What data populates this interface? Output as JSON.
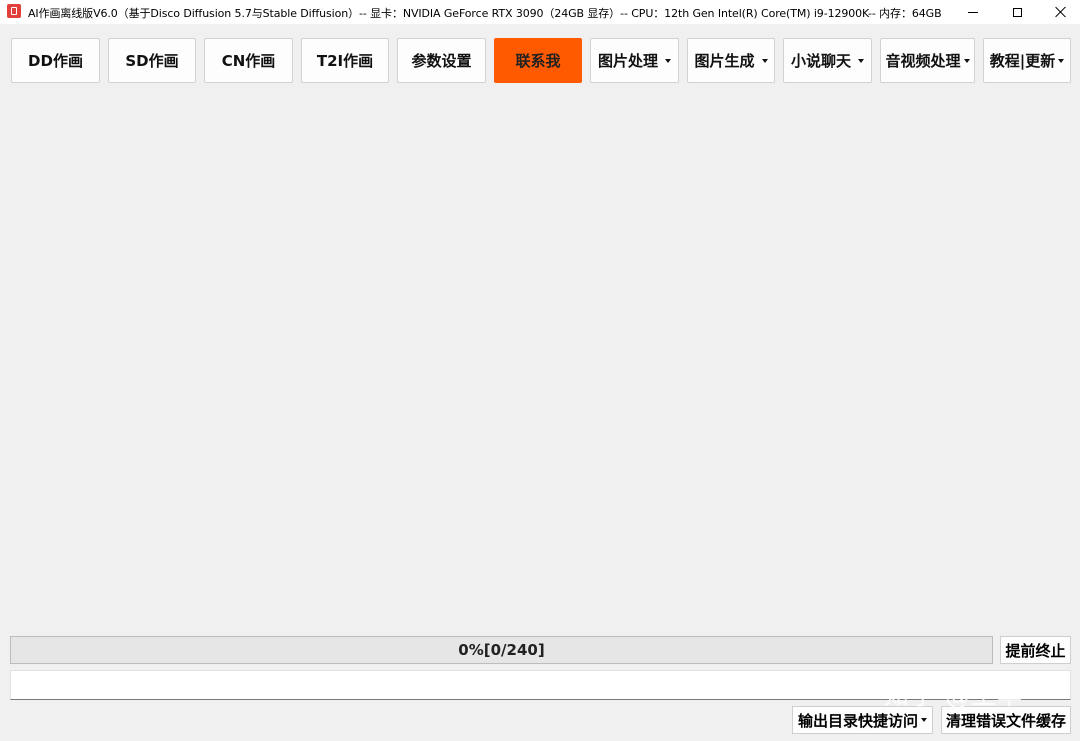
{
  "window": {
    "title": "AI作画离线版V6.0（基于Disco Diffusion 5.7与Stable Diffusion）-- 显卡：NVIDIA GeForce RTX 3090（24GB 显存）-- CPU：12th Gen Intel(R) Core(TM) i9-12900K-- 内存：64GB",
    "app_icon": "app-icon",
    "controls": [
      "minimize-icon",
      "maximize-icon",
      "close-icon"
    ]
  },
  "nav": {
    "buttons": [
      {
        "label": "DD作画"
      },
      {
        "label": "SD作画"
      },
      {
        "label": "CN作画"
      },
      {
        "label": "T2I作画"
      },
      {
        "label": "参数设置"
      },
      {
        "label": "联系我"
      },
      {
        "label": "图片处理"
      },
      {
        "label": "图片生成"
      },
      {
        "label": "小说聊天"
      },
      {
        "label": "音视频处理"
      },
      {
        "label": "教程|更新"
      }
    ],
    "active_color": "#ff5a00"
  },
  "progress": {
    "text": "0%[0/240]",
    "percent": 0,
    "done": 0,
    "total": 240
  },
  "stop_button": {
    "label": "提前终止"
  },
  "log": {
    "value": ""
  },
  "bottom": {
    "output_dir_label": "输出目录快捷访问",
    "clear_cache_label": "清理错误文件缓存"
  },
  "watermark": "知乎 @王华"
}
